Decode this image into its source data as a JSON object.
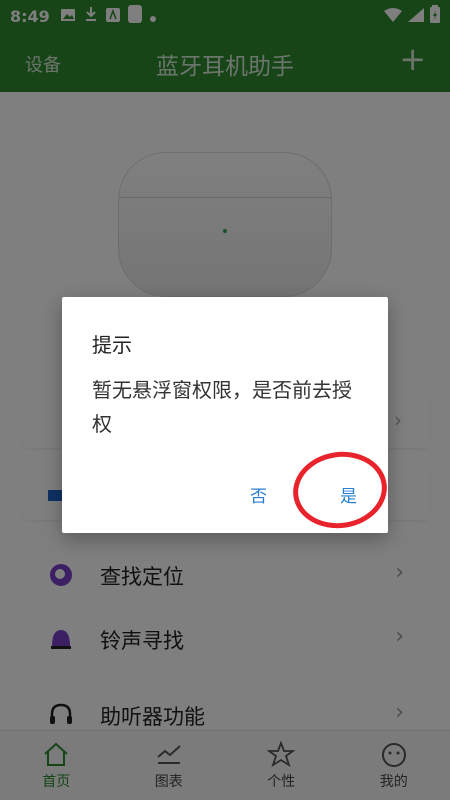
{
  "status_bar": {
    "time": "8:49"
  },
  "app_bar": {
    "left_label": "设备",
    "title": "蓝牙耳机助手",
    "plus": "+"
  },
  "list": [
    {
      "label": "查找定位"
    },
    {
      "label": "铃声寻找"
    },
    {
      "label": "助听器功能"
    }
  ],
  "bottom_nav": [
    {
      "label": "首页"
    },
    {
      "label": "图表"
    },
    {
      "label": "个性"
    },
    {
      "label": "我的"
    }
  ],
  "dialog": {
    "title": "提示",
    "message": "暂无悬浮窗权限，是否前去授权",
    "cancel_label": "否",
    "confirm_label": "是"
  },
  "colors": {
    "brand": "#2f8b2f",
    "link": "#2a7fd0",
    "highlight": "#e8232c"
  }
}
